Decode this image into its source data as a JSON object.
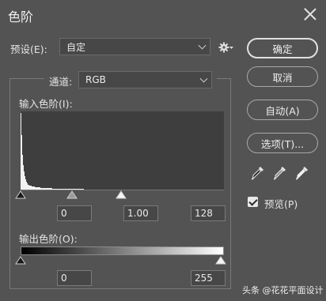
{
  "window": {
    "title": "色阶"
  },
  "preset": {
    "label": "预设(E):",
    "value": "自定"
  },
  "channel": {
    "label": "通道:",
    "value": "RGB"
  },
  "input_levels": {
    "label": "输入色阶(I):",
    "shadow": "0",
    "midtone": "1.00",
    "highlight": "128"
  },
  "output_levels": {
    "label": "输出色阶(O):",
    "shadow": "0",
    "highlight": "255"
  },
  "buttons": {
    "ok": "确定",
    "cancel": "取消",
    "auto": "自动(A)",
    "options": "选项(T)..."
  },
  "preview": {
    "label": "预览(P)",
    "checked": true
  },
  "icons": {
    "close": "close-icon",
    "gear": "gear-icon",
    "eyedroppers": [
      "black-eyedropper-icon",
      "gray-eyedropper-icon",
      "white-eyedropper-icon"
    ]
  },
  "watermark": "头条 @花花平面设计"
}
